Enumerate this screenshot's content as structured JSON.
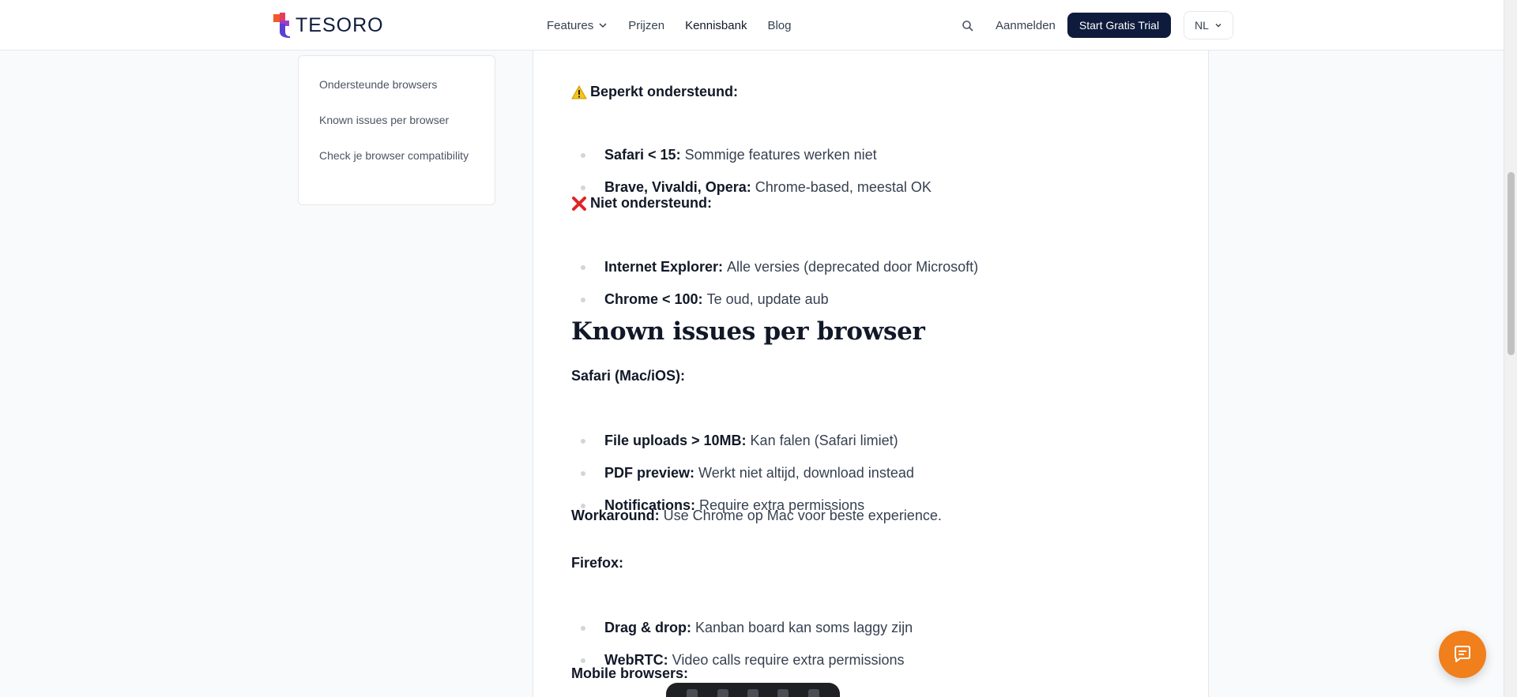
{
  "nav": {
    "logo_text": "TESORO",
    "links": [
      "Features",
      "Prijzen",
      "Kennisbank",
      "Blog"
    ],
    "login": "Aanmelden",
    "cta": "Start Gratis Trial",
    "language": "NL"
  },
  "toc": {
    "items": [
      "Ondersteunde browsers",
      "Known issues per browser",
      "Check je browser compatibility"
    ]
  },
  "article": {
    "limited": {
      "heading": "Beperkt ondersteund:",
      "items": [
        {
          "bold": "Safari < 15:",
          "text": "Sommige features werken niet"
        },
        {
          "bold": "Brave, Vivaldi, Opera:",
          "text": "Chrome-based, meestal OK"
        }
      ]
    },
    "unsupported": {
      "heading": "Niet ondersteund:",
      "items": [
        {
          "bold": "Internet Explorer:",
          "text": "Alle versies (deprecated door Microsoft)"
        },
        {
          "bold": "Chrome < 100:",
          "text": "Te oud, update aub"
        }
      ]
    },
    "known_issues_title": "Known issues per browser",
    "safari": {
      "heading": "Safari (Mac/iOS):",
      "items": [
        {
          "bold": "File uploads > 10MB:",
          "text": "Kan falen (Safari limiet)"
        },
        {
          "bold": "PDF preview:",
          "text": "Werkt niet altijd, download instead"
        },
        {
          "bold": "Notifications:",
          "text": "Require extra permissions"
        }
      ],
      "workaround_label": "Workaround:",
      "workaround_text": "Use Chrome op Mac voor beste experience."
    },
    "firefox": {
      "heading": "Firefox:",
      "items": [
        {
          "bold": "Drag & drop:",
          "text": "Kanban board kan soms laggy zijn"
        },
        {
          "bold": "WebRTC:",
          "text": "Video calls require extra permissions"
        }
      ]
    },
    "mobile_heading": "Mobile browsers:"
  },
  "colors": {
    "brand_dark": "#0f1b3d",
    "chat_orange": "#f07f1c"
  }
}
